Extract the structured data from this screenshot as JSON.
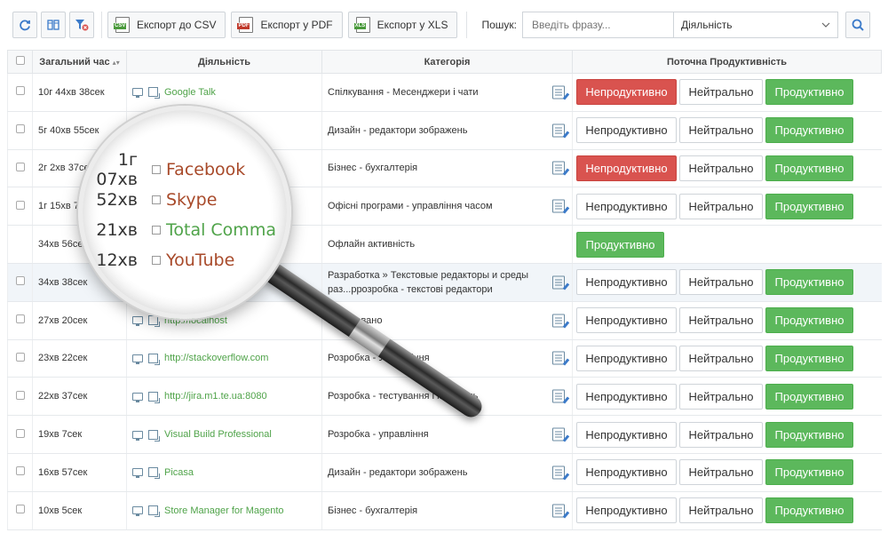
{
  "toolbar": {
    "export_csv": "Експорт до CSV",
    "export_pdf": "Експорт у PDF",
    "export_xls": "Експорт у XLS",
    "csv_tag": "CSV",
    "pdf_tag": "PDF",
    "xls_tag": "XLS",
    "search_label": "Пошук:",
    "search_placeholder": "Введіть фразу...",
    "search_scope": "Діяльність",
    "colors": {
      "csv": "#4a9a3c",
      "pdf": "#c0392b",
      "xls": "#4a9a3c",
      "accent": "#3b7ac9"
    }
  },
  "table": {
    "headers": {
      "time": "Загальний час",
      "activity": "Діяльність",
      "category": "Категорія",
      "productivity": "Поточна Продуктивність"
    },
    "buttons": {
      "unproductive": "Непродуктивно",
      "neutral": "Нейтрально",
      "productive": "Продуктивно"
    },
    "rows": [
      {
        "time": "10г 44хв 38сек",
        "activity": "Google Talk",
        "category": "Спілкування - Месенджери і чати",
        "state": "unproductive"
      },
      {
        "time": "5г 40хв 55сек",
        "activity": "",
        "category": "Дизайн - редактори зображень",
        "state": "productive"
      },
      {
        "time": "2г 2хв 37сек",
        "activity": "",
        "category": "Бізнес - бухгалтерія",
        "state": "unproductive"
      },
      {
        "time": "1г 15хв 7",
        "activity": "",
        "category": "Офісні програми - управління часом",
        "state": "productive"
      },
      {
        "time": "34хв 56сек",
        "activity": "",
        "category": "Офлайн активність",
        "state": "single"
      },
      {
        "time": "34хв 38сек",
        "activity": "",
        "category": "Разработка » Текстовые редакторы и среды раз...ррозробка - текстові редактори",
        "state": "productive"
      },
      {
        "time": "27хв 20сек",
        "activity": "http://localhost",
        "category": "Не ка...вано",
        "state": "productive"
      },
      {
        "time": "23хв 22сек",
        "activity": "http://stackoverflow.com",
        "category": "Розробка - Управління",
        "state": "productive"
      },
      {
        "time": "22хв 37сек",
        "activity": "http://jira.m1.te.ua:8080",
        "category": "Розробка - тестування і контроль",
        "state": "productive"
      },
      {
        "time": "19хв 7сек",
        "activity": "Visual Build Professional",
        "category": "Розробка - управління",
        "state": "productive"
      },
      {
        "time": "16хв 57сек",
        "activity": "Picasa",
        "category": "Дизайн - редактори зображень",
        "state": "productive"
      },
      {
        "time": "10хв 5сек",
        "activity": "Store Manager for Magento",
        "category": "Бізнес - бухгалтерія",
        "state": "productive"
      }
    ]
  },
  "magnifier": {
    "rows": [
      {
        "time": "1г 07хв",
        "name": "Facebook",
        "color": "#a84a2a"
      },
      {
        "time": "52хв",
        "name": "Skype",
        "color": "#a84a2a"
      },
      {
        "time": "21хв",
        "name": "Total Comma",
        "color": "#4fa349"
      },
      {
        "time": "12хв",
        "name": "YouTube",
        "color": "#a84a2a"
      }
    ]
  }
}
